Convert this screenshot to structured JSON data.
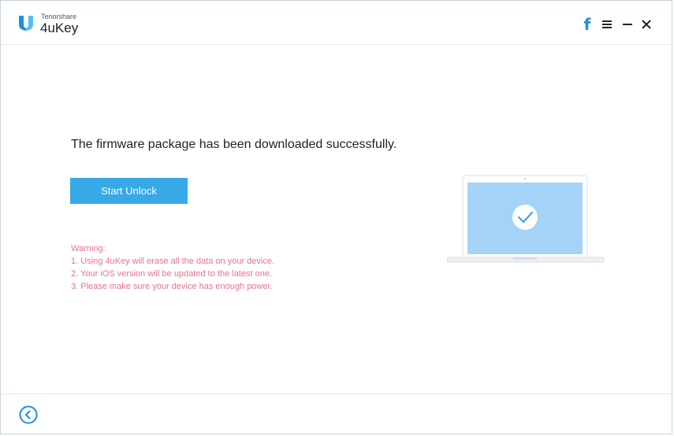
{
  "app": {
    "brand_small": "Tenorshare",
    "brand_name": "4uKey"
  },
  "titlebar": {
    "facebook_label": "f"
  },
  "main": {
    "message": "The firmware package has been downloaded successfully.",
    "start_button": "Start Unlock",
    "warning": {
      "title": "Warning:",
      "lines": [
        "1. Using 4uKey will erase all the data on your device.",
        "2. Your iOS version will be updated to the latest one.",
        "3. Please make sure your device has enough power."
      ]
    }
  },
  "colors": {
    "accent": "#38a9e6",
    "warning": "#e8738a",
    "facebook": "#1e8fe1"
  },
  "icons": [
    "logo-icon",
    "facebook-icon",
    "menu-icon",
    "minimize-icon",
    "close-icon",
    "laptop-check-illustration",
    "back-arrow-icon"
  ]
}
